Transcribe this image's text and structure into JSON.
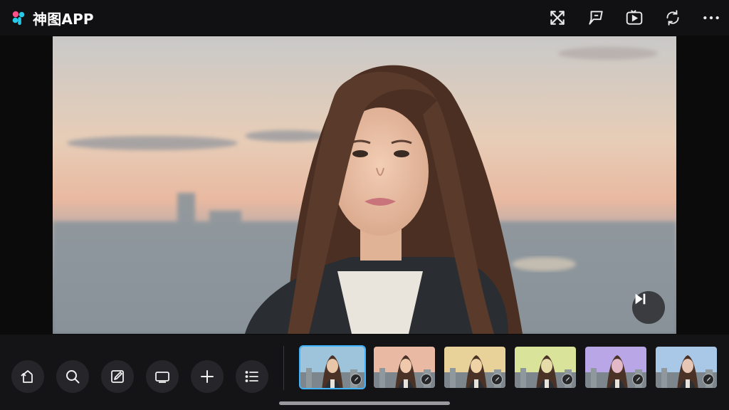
{
  "app": {
    "title": "神图APP"
  },
  "header": {
    "actions": [
      {
        "icon": "shuffle-icon"
      },
      {
        "icon": "comment-icon"
      },
      {
        "icon": "play-video-icon"
      },
      {
        "icon": "refresh-icon"
      },
      {
        "icon": "more-icon"
      }
    ]
  },
  "viewer": {
    "overlay_icon": "skip-next-icon"
  },
  "toolbar": {
    "tools": [
      {
        "icon": "rotate-icon"
      },
      {
        "icon": "search-icon"
      },
      {
        "icon": "edit-icon"
      },
      {
        "icon": "frame-icon"
      },
      {
        "icon": "add-icon"
      },
      {
        "icon": "list-icon"
      }
    ]
  },
  "filmstrip": {
    "selected_index": 0,
    "thumbnails": [
      {
        "sky": "#9ec4dc",
        "tone": "#e8c6a8"
      },
      {
        "sky": "#e9b9a4",
        "tone": "#f0c9ad"
      },
      {
        "sky": "#e8d29a",
        "tone": "#efd3a6"
      },
      {
        "sky": "#d9e49a",
        "tone": "#e6dcaa"
      },
      {
        "sky": "#b9a6e6",
        "tone": "#e3b8c7"
      },
      {
        "sky": "#a9c8e8",
        "tone": "#e8c6b6"
      }
    ]
  },
  "colors": {
    "accent": "#41b4ff",
    "logo_pink": "#ff4f86",
    "logo_cyan": "#27c9e8"
  }
}
